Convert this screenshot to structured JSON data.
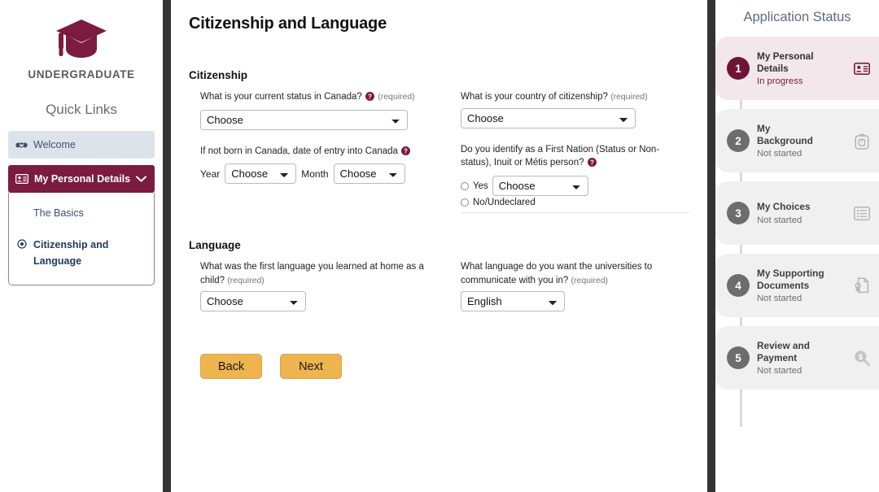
{
  "colors": {
    "brand_maroon": "#7b1b3f",
    "brand_maroon_dark": "#6e1434",
    "button_amber": "#eeb44f",
    "welcome_bg": "#dde3ea",
    "step_gray": "#6d6d6d",
    "separator_dark": "#333333"
  },
  "sidebar": {
    "logo_icon": "graduation-cap-icon",
    "brand_name": "UNDERGRADUATE",
    "quick_links_title": "Quick Links",
    "items": [
      {
        "label": "Welcome",
        "icon": "handshake-icon",
        "state": "default"
      },
      {
        "label": "My Personal Details",
        "icon": "id-card-icon",
        "state": "active",
        "chevron": "chevron-down-icon"
      }
    ],
    "subitems": [
      {
        "label": "The Basics",
        "current": false
      },
      {
        "label": "Citizenship and Language",
        "current": true,
        "bullet": "target-circle-icon"
      }
    ]
  },
  "main": {
    "page_title": "Citizenship and Language",
    "sections": [
      {
        "heading": "Citizenship",
        "fields_left": [
          {
            "label": "What is your current status in Canada?",
            "help": "help-icon",
            "required_text": "(required)",
            "control": "select",
            "value": "Choose"
          },
          {
            "label": "If not born in Canada, date of entry into Canada",
            "help": "help-icon",
            "required_text": "",
            "control": "year-month",
            "year_label": "Year",
            "year_value": "Choose",
            "month_label": "Month",
            "month_value": "Choose"
          }
        ],
        "fields_right": [
          {
            "label": "What is your country of citizenship?",
            "help": "",
            "required_text": "(required)",
            "control": "select",
            "value": "Choose"
          },
          {
            "label": "Do you identify as a First Nation (Status or Non-status), Inuit or Métis person?",
            "help": "help-icon",
            "required_text": "",
            "control": "radio-select",
            "yes_label": "Yes",
            "yes_value": "Choose",
            "no_label": "No/Undeclared"
          }
        ]
      },
      {
        "heading": "Language",
        "fields_left": [
          {
            "label": "What was the first language you learned at home as a child?",
            "help": "",
            "required_text": "(required)",
            "control": "select",
            "value": "Choose"
          }
        ],
        "fields_right": [
          {
            "label": "What language do you want the universities to communicate with you in?",
            "help": "",
            "required_text": "(required)",
            "control": "select",
            "value": "English"
          }
        ]
      }
    ],
    "buttons": {
      "back": "Back",
      "next": "Next"
    }
  },
  "status_panel": {
    "title": "Application Status",
    "steps": [
      {
        "num": "1",
        "name": "My Personal Details",
        "status": "In progress",
        "icon": "id-card-icon",
        "active": true
      },
      {
        "num": "2",
        "name": "My Background",
        "status": "Not started",
        "icon": "backpack-icon",
        "active": false
      },
      {
        "num": "3",
        "name": "My Choices",
        "status": "Not started",
        "icon": "list-icon",
        "active": false
      },
      {
        "num": "4",
        "name": "My Supporting Documents",
        "status": "Not started",
        "icon": "document-seal-icon",
        "active": false
      },
      {
        "num": "5",
        "name": "Review and Payment",
        "status": "Not started",
        "icon": "money-search-icon",
        "active": false
      }
    ]
  }
}
